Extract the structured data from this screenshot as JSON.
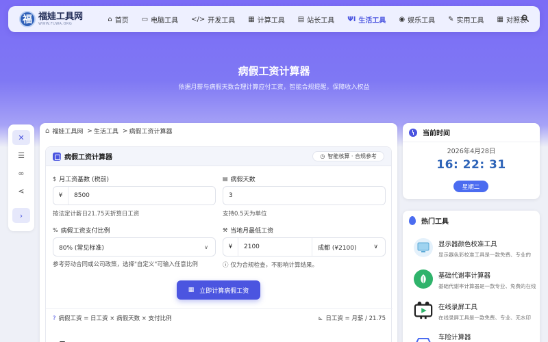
{
  "site": {
    "logo_char": "福",
    "name": "福娃工具网",
    "url": "WWW.FUWA.ORG"
  },
  "nav": {
    "items": [
      {
        "label": "首页",
        "icon": "home-icon",
        "glyph": "⌂"
      },
      {
        "label": "电脑工具",
        "icon": "desktop-icon",
        "glyph": "▭"
      },
      {
        "label": "开发工具",
        "icon": "code-icon",
        "glyph": "</>"
      },
      {
        "label": "计算工具",
        "icon": "calculator-icon",
        "glyph": "▦"
      },
      {
        "label": "站长工具",
        "icon": "toolbox-icon",
        "glyph": "▤"
      },
      {
        "label": "生活工具",
        "icon": "utensils-icon",
        "glyph": "ΨΙ",
        "active": true
      },
      {
        "label": "娱乐工具",
        "icon": "gamepad-icon",
        "glyph": "◉"
      },
      {
        "label": "实用工具",
        "icon": "wrench-icon",
        "glyph": "✎"
      },
      {
        "label": "对照表",
        "icon": "table-icon",
        "glyph": "▦"
      }
    ],
    "search_icon": "search-icon",
    "active_color": "#4b55e0"
  },
  "hero": {
    "title": "病假工资计算器",
    "subtitle": "依据月薪与病假天数合理计算应付工资，智能合规提醒，保障收入权益"
  },
  "breadcrumb": {
    "home": "福娃工具网",
    "category": "生活工具",
    "current": "病假工资计算器"
  },
  "calculator": {
    "title": "病假工资计算器",
    "badge": "智能核算 · 合规参考",
    "salary": {
      "label": "月工资基数 (税前)",
      "label_glyph": "$",
      "prefix": "¥",
      "value": "8500",
      "help": "按法定计薪日21.75天折算日工资"
    },
    "days": {
      "label": "病假天数",
      "value": "3",
      "help": "支持0.5天为单位"
    },
    "ratio": {
      "label": "病假工资支付比例",
      "selected": "80% (常见标准)",
      "help": "参考劳动合同或公司政策，选择\"自定义\"可输入任意比例"
    },
    "min_wage": {
      "label": "当地月最低工资",
      "prefix": "¥",
      "value": "2100",
      "city": "成都 (¥2100)",
      "help": "仅为合规检查，不影响计算结果。"
    },
    "button": "立即计算病假工资",
    "formula_left": "病假工资 = 日工资 × 病假天数 × 支付比例",
    "formula_right": "日工资 = 月薪 / 21.75"
  },
  "time_card": {
    "title": "当前时间",
    "date": "2026年4月28日",
    "time": "16: 22: 31",
    "weekday": "星期二"
  },
  "hot_tools": {
    "title": "热门工具",
    "items": [
      {
        "name": "显示器颜色校准工具",
        "desc": "显示器色彩校准工具是一款免费、专业的",
        "icon": "monitor-icon",
        "color": "#9fd3f0"
      },
      {
        "name": "基础代谢率计算器",
        "desc": "基础代谢率计算器是一款专业、免费的在线",
        "icon": "leaf-icon",
        "color": "#2fb36b"
      },
      {
        "name": "在线录屏工具",
        "desc": "在线录屏工具是一款免费、专业、无水印",
        "icon": "screen-record-icon",
        "color": "#222222"
      },
      {
        "name": "车险计算器",
        "desc": "",
        "icon": "car-icon",
        "color": "#4b6cf0"
      }
    ]
  }
}
